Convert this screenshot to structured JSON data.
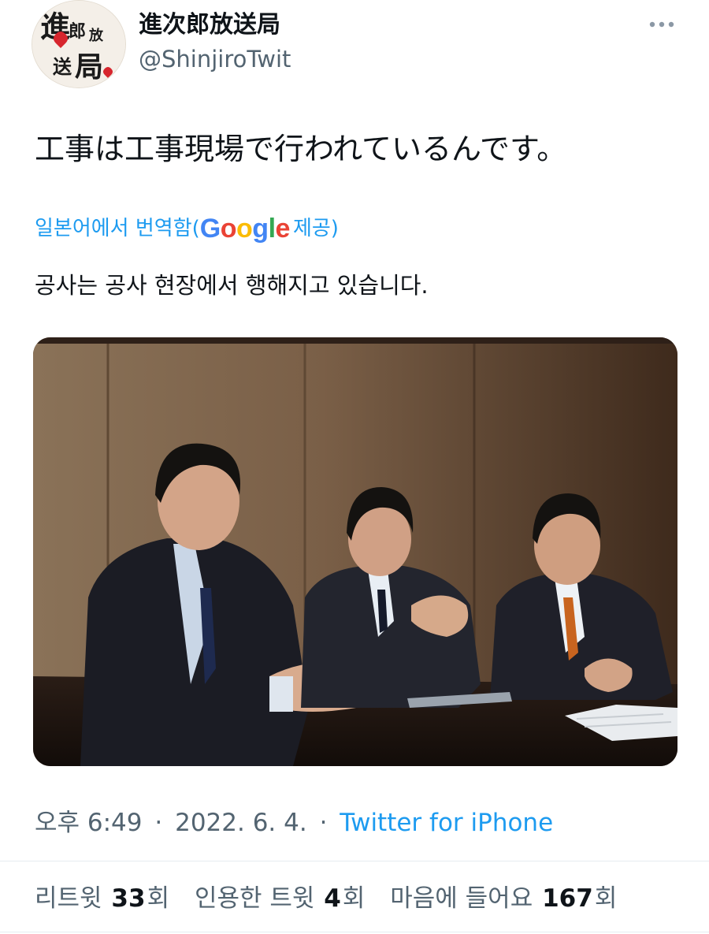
{
  "author": {
    "display_name": "進次郎放送局",
    "handle": "@ShinjiroTwit",
    "avatar_text": "進次郎放送局"
  },
  "tweet": {
    "text": "工事は工事現場で行われているんです。",
    "translation_prefix": "일본어에서 번역함(",
    "translation_provider": "Google",
    "translation_suffix": " 제공)",
    "translated_text": "공사는 공사 현장에서 행해지고 있습니다."
  },
  "meta": {
    "time": "오후 6:49",
    "date": "2022. 6. 4.",
    "separator": "·",
    "source": "Twitter for iPhone"
  },
  "stats": {
    "retweets_label": "리트윗",
    "retweets_count": "33",
    "retweets_unit": "회",
    "quotes_label": "인용한 트윗",
    "quotes_count": "4",
    "quotes_unit": "회",
    "likes_label": "마음에 들어요",
    "likes_count": "167",
    "likes_unit": "회"
  },
  "icons": {
    "more": "more-horizontal-icon"
  },
  "colors": {
    "link": "#1d9bf0",
    "secondary_text": "#536471",
    "primary_text": "#0f1419"
  }
}
